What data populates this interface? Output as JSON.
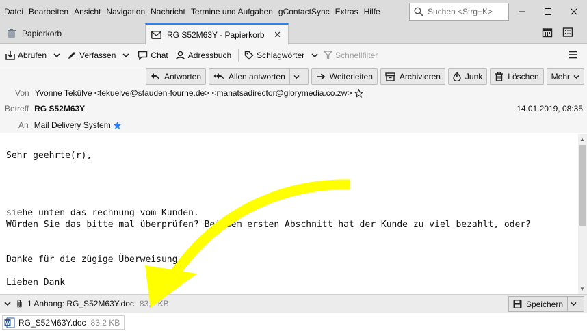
{
  "menu": {
    "items": [
      "Datei",
      "Bearbeiten",
      "Ansicht",
      "Navigation",
      "Nachricht",
      "Termine und Aufgaben",
      "gContactSync",
      "Extras",
      "Hilfe"
    ],
    "search_placeholder": "Suchen <Strg+K>"
  },
  "tabs": [
    {
      "label": "Papierkorb",
      "icon": "trash-folder-icon"
    },
    {
      "label": "RG S52M63Y - Papierkorb",
      "icon": "envelope-icon",
      "active": true
    }
  ],
  "toolbar": {
    "fetch": "Abrufen",
    "compose": "Verfassen",
    "chat": "Chat",
    "addressbook": "Adressbuch",
    "tags": "Schlagwörter",
    "quickfilter": "Schnellfilter"
  },
  "actions": {
    "reply": "Antworten",
    "reply_all": "Allen antworten",
    "forward": "Weiterleiten",
    "archive": "Archivieren",
    "junk": "Junk",
    "delete": "Löschen",
    "more": "Mehr"
  },
  "header": {
    "from_label": "Von",
    "from": "Yvonne Tekülve <tekuelve@stauden-fourne.de> <manatsadirector@glorymedia.co.zw>",
    "subject_label": "Betreff",
    "subject": "RG S52M63Y",
    "date": "14.01.2019, 08:35",
    "to_label": "An",
    "to": "Mail Delivery System"
  },
  "body": {
    "greeting": "Sehr geehrte(r),",
    "line1": "siehe unten das rechnung vom Kunden.",
    "line2": "Würden Sie das bitte mal überprüfen? Bei dem ersten Abschnitt hat der Kunde zu viel bezahlt, oder?",
    "line3": "Danke für die zügige Überweisung.",
    "line4": "Lieben Dank"
  },
  "attachment": {
    "summary": "1 Anhang: RG_S52M63Y.doc",
    "size": "83,2 KB",
    "save": "Speichern",
    "filename": "RG_S52M63Y.doc"
  },
  "colors": {
    "accent": "#2a7fff",
    "highlight_arrow": "#ffff00",
    "chrome": "#dcdcdc"
  }
}
